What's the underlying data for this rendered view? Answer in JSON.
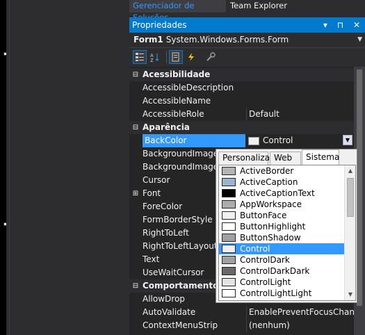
{
  "doc_tabs": [
    "Gerenciador de Soluções",
    "Team Explorer"
  ],
  "panel_title": "Propriedades",
  "panel_buttons": "▾ ⊓ ✕",
  "object": {
    "name": "Form1",
    "type": "System.Windows.Forms.Form"
  },
  "toolbar_icons": [
    "categorized-icon",
    "alphabetical-icon",
    "properties-icon",
    "events-icon",
    "property-pages-icon"
  ],
  "rows": [
    {
      "kind": "cat",
      "name": "Acessibilidade",
      "expander": "⊟"
    },
    {
      "kind": "prop",
      "name": "AccessibleDescription",
      "value": ""
    },
    {
      "kind": "prop",
      "name": "AccessibleName",
      "value": ""
    },
    {
      "kind": "prop",
      "name": "AccessibleRole",
      "value": "Default"
    },
    {
      "kind": "cat",
      "name": "Aparência",
      "expander": "⊟"
    },
    {
      "kind": "prop",
      "name": "BackColor",
      "value": "Control"
    },
    {
      "kind": "prop",
      "name": "BackgroundImage",
      "value": ""
    },
    {
      "kind": "prop",
      "name": "BackgroundImageLa",
      "value": ""
    },
    {
      "kind": "prop",
      "name": "Cursor",
      "value": ""
    },
    {
      "kind": "prop",
      "name": "Font",
      "value": "",
      "expander": "⊞"
    },
    {
      "kind": "prop",
      "name": "ForeColor",
      "value": ""
    },
    {
      "kind": "prop",
      "name": "FormBorderStyle",
      "value": ""
    },
    {
      "kind": "prop",
      "name": "RightToLeft",
      "value": ""
    },
    {
      "kind": "prop",
      "name": "RightToLeftLayout",
      "value": ""
    },
    {
      "kind": "prop",
      "name": "Text",
      "value": ""
    },
    {
      "kind": "prop",
      "name": "UseWaitCursor",
      "value": ""
    },
    {
      "kind": "cat",
      "name": "Comportamento",
      "expander": "⊟"
    },
    {
      "kind": "prop",
      "name": "AllowDrop",
      "value": ""
    },
    {
      "kind": "prop",
      "name": "AutoValidate",
      "value": "EnablePreventFocusChange"
    },
    {
      "kind": "prop",
      "name": "ContextMenuStrip",
      "value": "(nenhum)"
    }
  ],
  "picker": {
    "tabs": [
      "Personalizar",
      "Web",
      "Sistema"
    ],
    "active_tab": "Sistema",
    "colors": [
      {
        "name": "ActiveBorder",
        "swatch": "#b4b4b4"
      },
      {
        "name": "ActiveCaption",
        "swatch": "#99b4d1"
      },
      {
        "name": "ActiveCaptionText",
        "swatch": "#000000"
      },
      {
        "name": "AppWorkspace",
        "swatch": "#ababab"
      },
      {
        "name": "ButtonFace",
        "swatch": "#f0f0f0"
      },
      {
        "name": "ButtonHighlight",
        "swatch": "#ffffff"
      },
      {
        "name": "ButtonShadow",
        "swatch": "#a0a0a0"
      },
      {
        "name": "Control",
        "swatch": "#f0f0f0",
        "selected": true
      },
      {
        "name": "ControlDark",
        "swatch": "#a0a0a0"
      },
      {
        "name": "ControlDarkDark",
        "swatch": "#696969"
      },
      {
        "name": "ControlLight",
        "swatch": "#e3e3e3"
      },
      {
        "name": "ControlLightLight",
        "swatch": "#ffffff"
      }
    ]
  },
  "colors": {
    "accent": "#007acc",
    "selection": "#3399ff",
    "link_tab": "#3399ff"
  }
}
